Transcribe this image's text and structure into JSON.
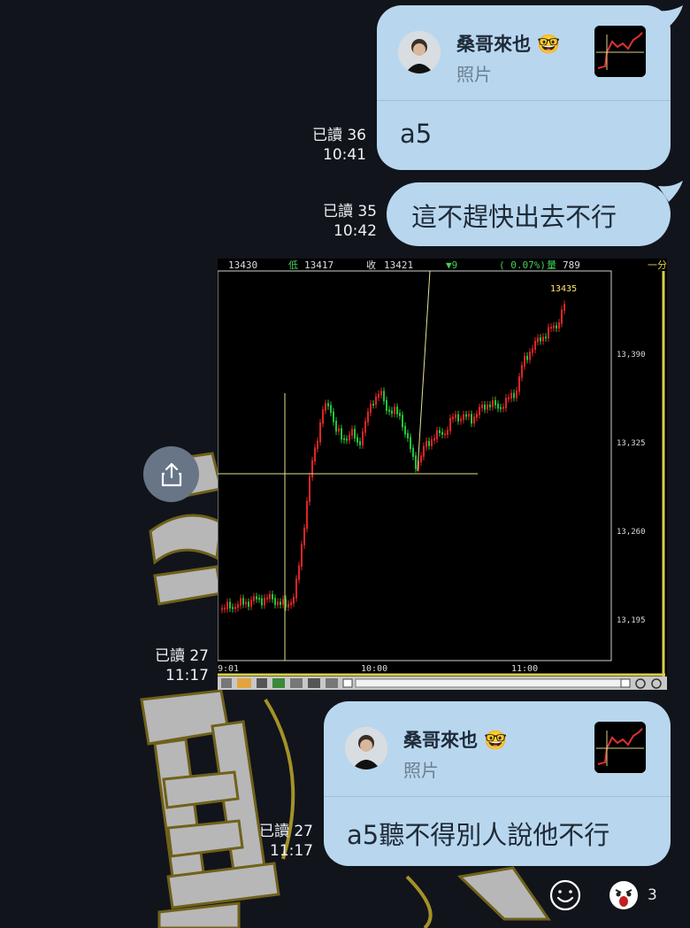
{
  "chat": {
    "messages": [
      {
        "quote_name": "桑哥來也",
        "quote_sub": "照片",
        "text": "a5",
        "read": "已讀 36",
        "time": "10:41"
      },
      {
        "text": "這不趕快出去不行",
        "read": "已讀 35",
        "time": "10:42"
      },
      {
        "type": "image",
        "read": "已讀 27",
        "time": "11:17",
        "chart_header": {
          "price": "13430",
          "low_label": "低",
          "low": "13417",
          "close_label": "收",
          "close": "13421",
          "change": "▼9",
          "pct": "( 0.07%)",
          "vol_label": "量",
          "vol": "789",
          "period": "一分"
        },
        "chart_annotation": "13435",
        "chart_data": {
          "type": "candlestick",
          "x_ticks": [
            "9:01",
            "10:00",
            "11:00"
          ],
          "y_ticks": [
            "13,390",
            "13,325",
            "13,260",
            "13,195"
          ],
          "ylim": [
            13170,
            13450
          ]
        }
      },
      {
        "quote_name": "桑哥來也",
        "quote_sub": "照片",
        "text": "a5聽不得別人說他不行",
        "read": "已讀 27",
        "time": "11:17"
      }
    ],
    "reactions": {
      "count": "3"
    }
  },
  "colors": {
    "bubble": "#b8d7ef",
    "background": "#11141b",
    "up_candle": "#e02424",
    "down_candle": "#22c43a"
  }
}
